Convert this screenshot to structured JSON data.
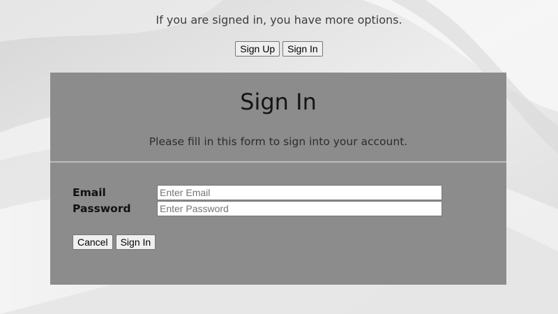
{
  "top": {
    "message": "If you are signed in, you have more options.",
    "sign_up_label": "Sign Up",
    "sign_in_label": "Sign In"
  },
  "panel": {
    "title": "Sign In",
    "subtitle": "Please fill in this form to sign into your account.",
    "email_label": "Email",
    "email_placeholder": "Enter Email",
    "email_value": "",
    "password_label": "Password",
    "password_placeholder": "Enter Password",
    "password_value": "",
    "cancel_label": "Cancel",
    "submit_label": "Sign In"
  },
  "colors": {
    "panel_background": "#8c8c8c",
    "page_background": "#e6e6e6"
  }
}
